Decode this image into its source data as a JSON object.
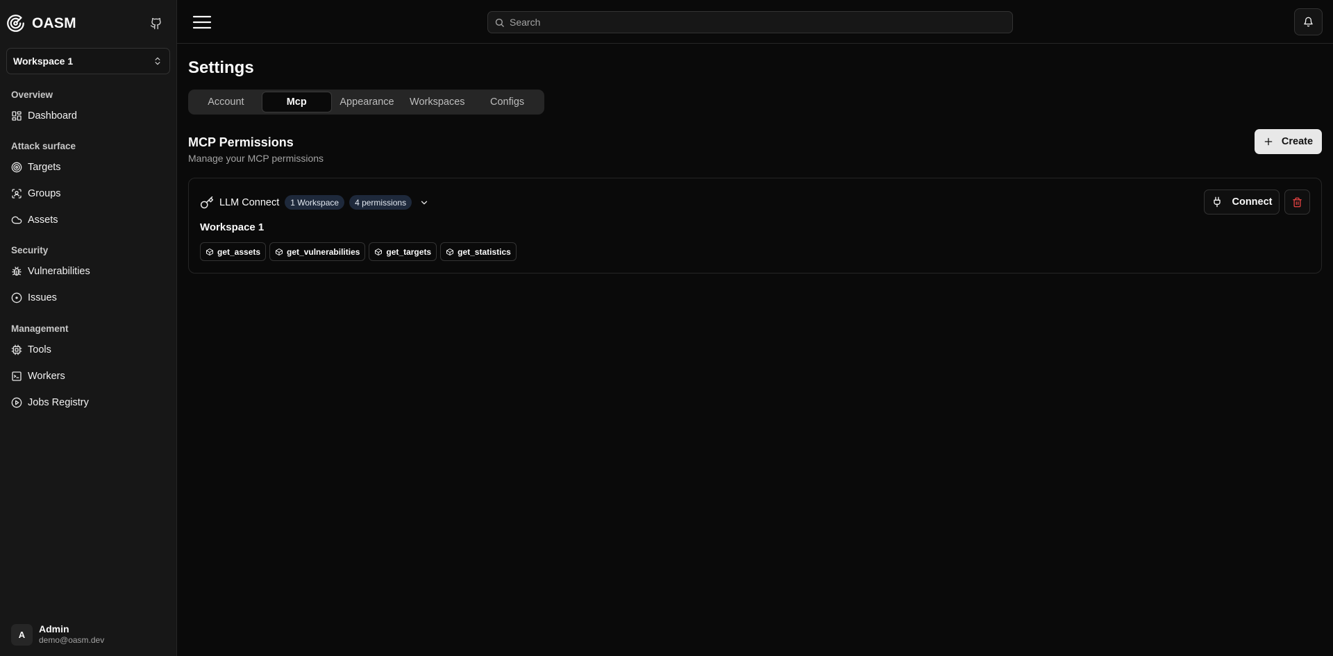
{
  "brand": {
    "name": "OASM"
  },
  "workspace_selector": {
    "value": "Workspace 1"
  },
  "sidebar": {
    "groups": [
      {
        "title": "Overview",
        "items": [
          {
            "label": "Dashboard",
            "icon": "dashboard-icon"
          }
        ]
      },
      {
        "title": "Attack surface",
        "items": [
          {
            "label": "Targets",
            "icon": "target-icon"
          },
          {
            "label": "Groups",
            "icon": "groups-icon"
          },
          {
            "label": "Assets",
            "icon": "cloud-icon"
          }
        ]
      },
      {
        "title": "Security",
        "items": [
          {
            "label": "Vulnerabilities",
            "icon": "bug-icon"
          },
          {
            "label": "Issues",
            "icon": "circle-dot-icon"
          }
        ]
      },
      {
        "title": "Management",
        "items": [
          {
            "label": "Tools",
            "icon": "cpu-icon"
          },
          {
            "label": "Workers",
            "icon": "terminal-icon"
          },
          {
            "label": "Jobs Registry",
            "icon": "play-circle-icon"
          }
        ]
      }
    ]
  },
  "user": {
    "initial": "A",
    "name": "Admin",
    "email": "demo@oasm.dev"
  },
  "search": {
    "placeholder": "Search"
  },
  "page": {
    "title": "Settings",
    "tabs": [
      "Account",
      "Mcp",
      "Appearance",
      "Workspaces",
      "Configs"
    ],
    "active_tab": "Mcp"
  },
  "mcp": {
    "title": "MCP Permissions",
    "subtitle": "Manage your MCP permissions",
    "create_label": "Create",
    "card": {
      "name": "LLM Connect",
      "badges": [
        "1 Workspace",
        "4 permissions"
      ],
      "connect_label": "Connect",
      "workspace": "Workspace 1",
      "permissions": [
        "get_assets",
        "get_vulnerabilities",
        "get_targets",
        "get_statistics"
      ]
    }
  },
  "colors": {
    "background": "#0a0a0a",
    "sidebar": "#171717",
    "badge": "#1e293b",
    "danger": "#ef4444"
  }
}
